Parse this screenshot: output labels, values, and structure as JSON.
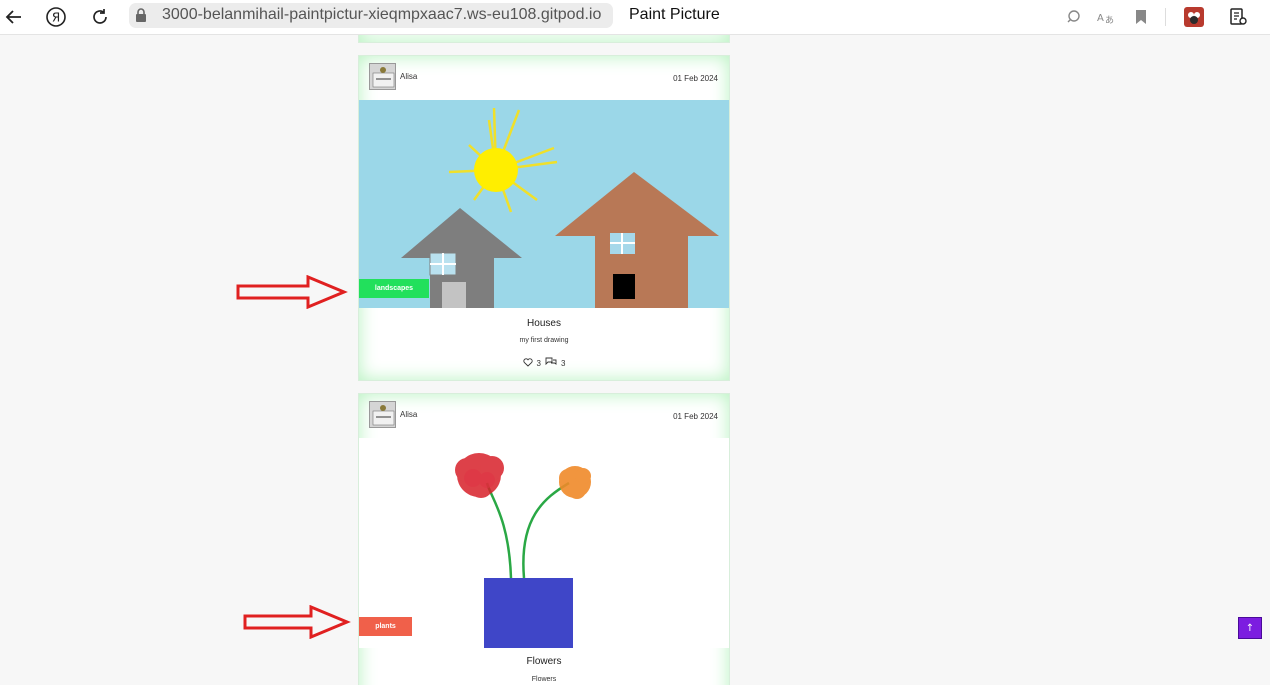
{
  "browser": {
    "url": "3000-belanmihail-paintpictur-xieqmpxaac7.ws-eu108.gitpod.io",
    "tab_title": "Paint Picture",
    "icons": [
      "back-arrow-icon",
      "yandex-icon",
      "reload-icon",
      "lock-icon",
      "search-icon",
      "translate-icon",
      "bookmark-icon",
      "extension-icon",
      "reading-mode-icon"
    ]
  },
  "posts": [
    {
      "author": "Alisa",
      "date": "01 Feb 2024",
      "category": "landscapes",
      "category_color": "#22e05c",
      "title": "Houses",
      "description": "my first drawing",
      "likes": "3",
      "comments": "3"
    },
    {
      "author": "Alisa",
      "date": "01 Feb 2024",
      "category": "plants",
      "category_color": "#f0604a",
      "title": "Flowers",
      "description": "Flowers"
    }
  ],
  "colors": {
    "card_glow": "#b6f2bf",
    "annotation_arrow": "#e02020",
    "scroll_top_button": "#7c1de0"
  }
}
